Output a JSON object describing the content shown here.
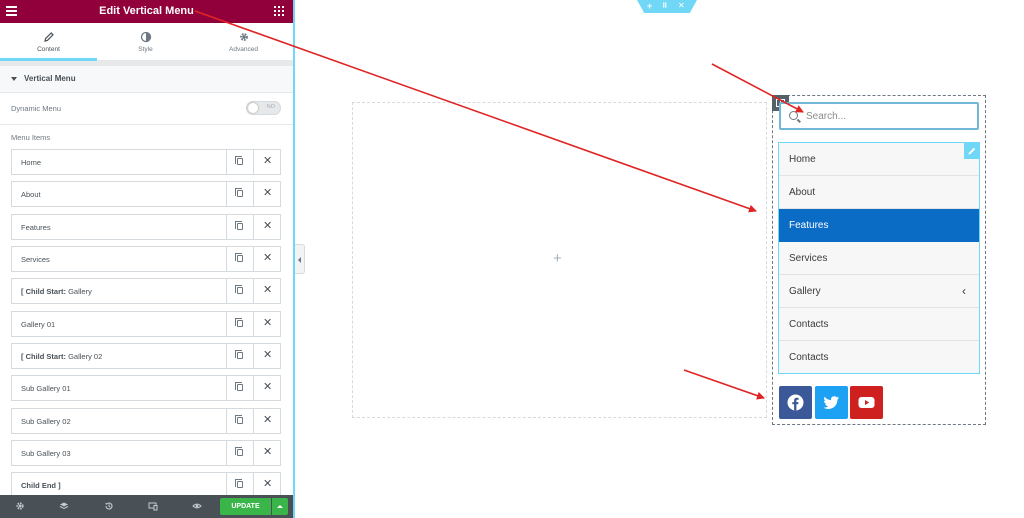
{
  "panel": {
    "title": "Edit Vertical Menu",
    "tabs": [
      {
        "label": "Content",
        "icon": "pencil-icon",
        "active": true
      },
      {
        "label": "Style",
        "icon": "half-circle-icon",
        "active": false
      },
      {
        "label": "Advanced",
        "icon": "gear-icon",
        "active": false
      }
    ],
    "section_title": "Vertical Menu",
    "dynamic_menu": {
      "label": "Dynamic Menu",
      "toggle_text": "NO",
      "enabled": false
    },
    "menu_items_label": "Menu Items",
    "menu_items": [
      {
        "prefix": "",
        "text": "Home"
      },
      {
        "prefix": "",
        "text": "About"
      },
      {
        "prefix": "",
        "text": "Features"
      },
      {
        "prefix": "",
        "text": "Services"
      },
      {
        "prefix": "[ Child Start:",
        "text": " Gallery"
      },
      {
        "prefix": "",
        "text": "Gallery 01"
      },
      {
        "prefix": "[ Child Start:",
        "text": " Gallery 02"
      },
      {
        "prefix": "",
        "text": "Sub Gallery 01"
      },
      {
        "prefix": "",
        "text": "Sub Gallery 02"
      },
      {
        "prefix": "",
        "text": "Sub Gallery 03"
      },
      {
        "prefix": "Child End ]",
        "text": ""
      }
    ],
    "footer": {
      "icons": [
        "gear-icon",
        "layers-icon",
        "history-icon",
        "responsive-icon",
        "eye-icon"
      ],
      "update_label": "UPDATE"
    }
  },
  "canvas": {
    "section_handle_icons": [
      "plus-icon",
      "drag-icon",
      "close-icon"
    ],
    "empty_column_add": "+",
    "search": {
      "placeholder": "Search..."
    },
    "vertical_menu": [
      {
        "label": "Home",
        "active": false,
        "has_children": false
      },
      {
        "label": "About",
        "active": false,
        "has_children": false
      },
      {
        "label": "Features",
        "active": true,
        "has_children": false
      },
      {
        "label": "Services",
        "active": false,
        "has_children": false
      },
      {
        "label": "Gallery",
        "active": false,
        "has_children": true
      },
      {
        "label": "Contacts",
        "active": false,
        "has_children": false
      },
      {
        "label": "Contacts",
        "active": false,
        "has_children": false
      }
    ],
    "social": [
      {
        "name": "facebook",
        "color": "#3b5998"
      },
      {
        "name": "twitter",
        "color": "#1da1f2"
      },
      {
        "name": "youtube",
        "color": "#cd201f"
      }
    ]
  },
  "colors": {
    "header": "#92003b",
    "accent": "#71d7f7",
    "active_menu": "#0b6cc6",
    "update": "#39b54a",
    "arrow": "#e02424"
  }
}
